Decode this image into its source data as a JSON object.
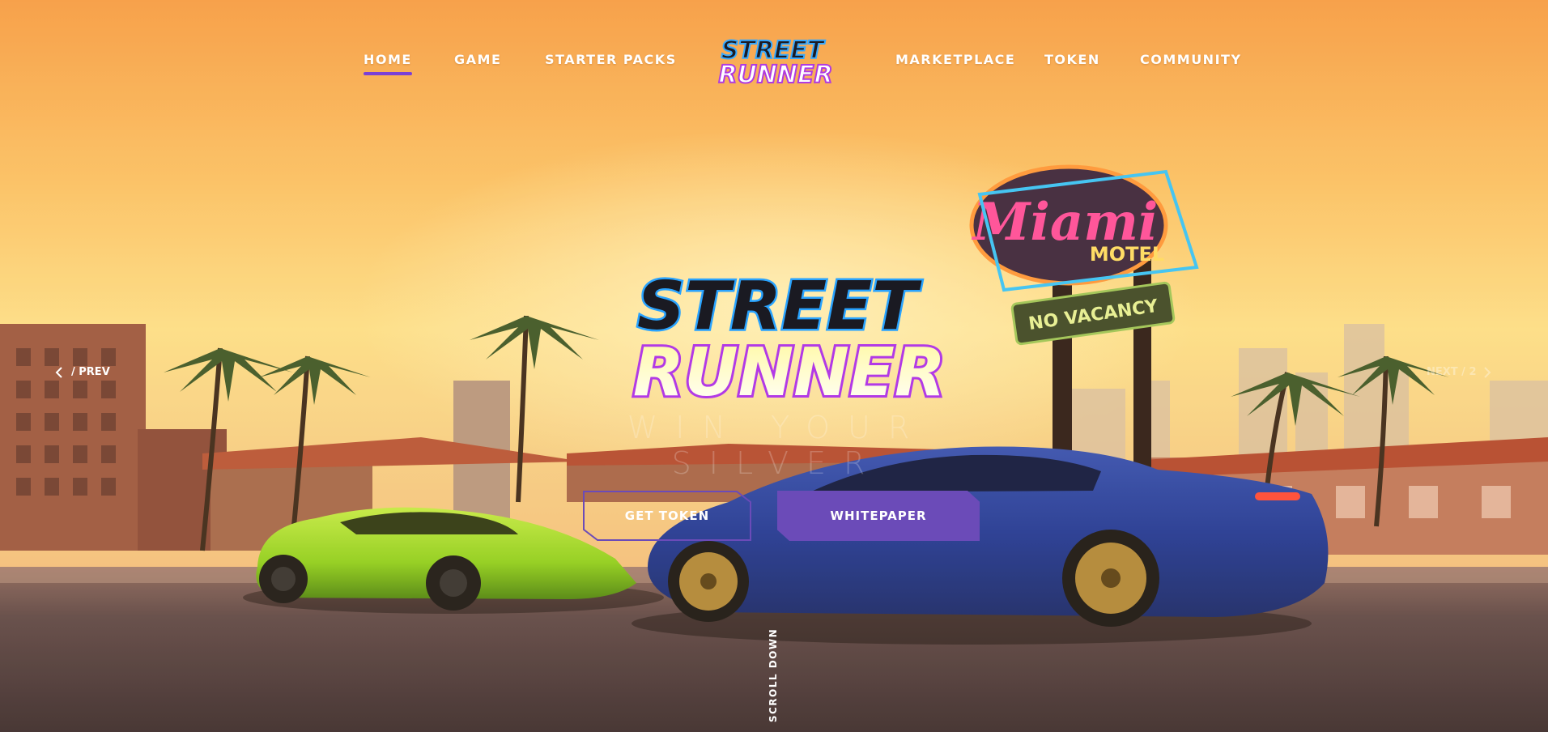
{
  "nav": {
    "items": [
      {
        "label": "HOME",
        "active": true
      },
      {
        "label": "GAME"
      },
      {
        "label": "STARTER PACKS"
      },
      {
        "label": "MARKETPLACE"
      },
      {
        "label": "TOKEN"
      },
      {
        "label": "COMMUNITY"
      }
    ],
    "logo": {
      "line1": "STREET",
      "line2": "RUNNER"
    }
  },
  "hero": {
    "logo": {
      "line1": "STREET",
      "line2": "RUNNER"
    },
    "tagline": "WIN YOUR SILVER",
    "sign": {
      "script": "Miami",
      "word": "MOTEL",
      "sub": "NO VACANCY"
    },
    "buttons": {
      "get_token": "GET TOKEN",
      "whitepaper": "WHITEPAPER"
    },
    "prev_label": "/ PREV",
    "next_label": "NEXT / 2",
    "scroll_label": "SCROLL DOWN"
  },
  "colors": {
    "accent": "#7b3fd6",
    "button_fill": "#6b4bb8",
    "sky_top": "#f7a14c",
    "sky_mid": "#fde08a"
  },
  "icons": {
    "prev": "chevron-left-icon",
    "next": "chevron-right-icon"
  }
}
